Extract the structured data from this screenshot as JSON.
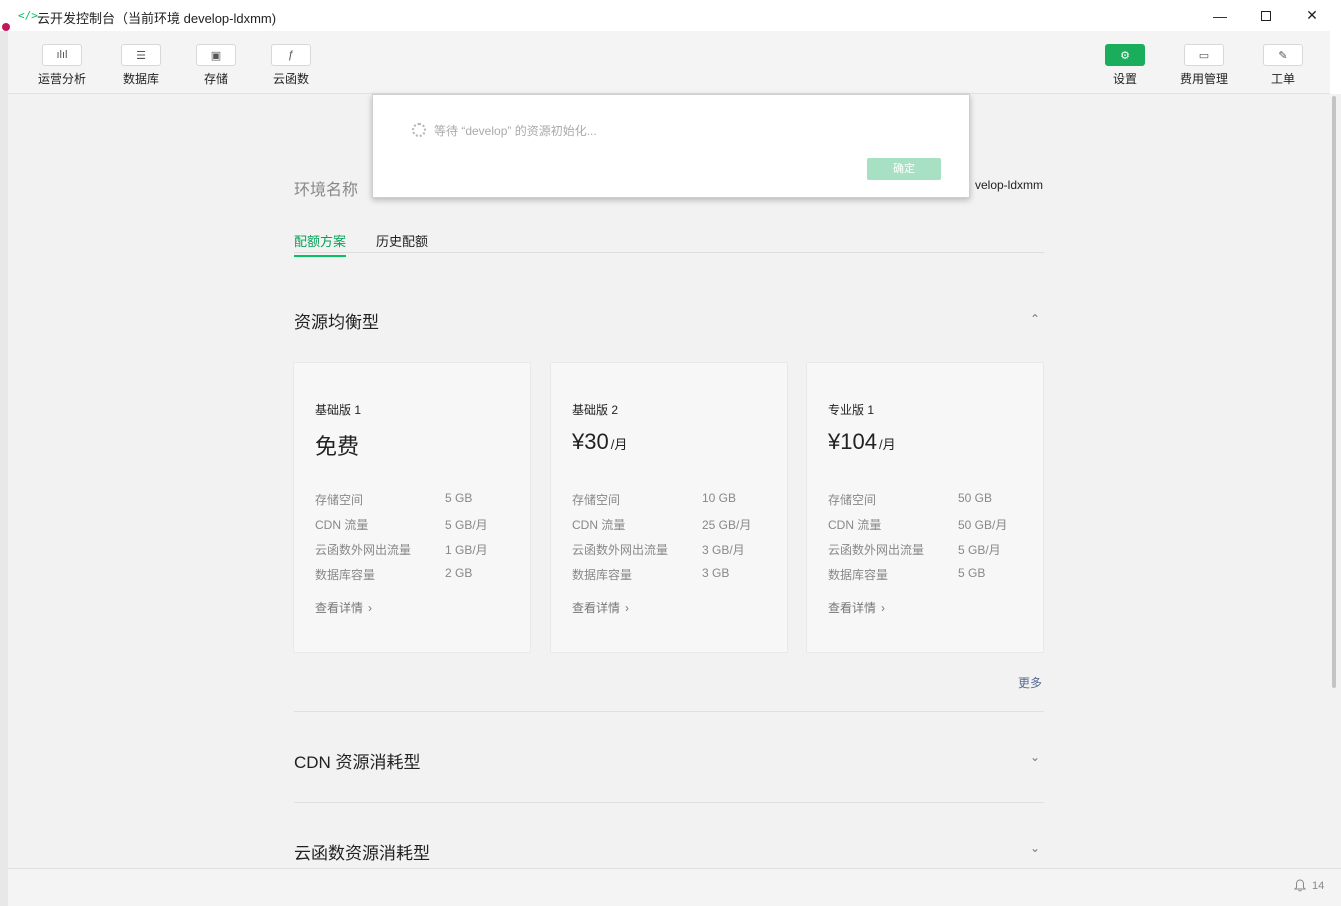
{
  "window": {
    "app_icon": "</>",
    "title": "云开发控制台（当前环境 develop-ldxmm)",
    "minimize": "—",
    "close": "✕"
  },
  "toolbar": {
    "left": [
      {
        "label": "运营分析",
        "icon": "bar-chart-icon",
        "glyph": "ılıl"
      },
      {
        "label": "数据库",
        "icon": "database-icon",
        "glyph": "☰"
      },
      {
        "label": "存储",
        "icon": "storage-icon",
        "glyph": "▣"
      },
      {
        "label": "云函数",
        "icon": "function-icon",
        "glyph": "ƒ"
      }
    ],
    "right": [
      {
        "label": "设置",
        "icon": "gear-icon",
        "glyph": "⚙",
        "active": true
      },
      {
        "label": "费用管理",
        "icon": "billing-icon",
        "glyph": "▭"
      },
      {
        "label": "工单",
        "icon": "ticket-icon",
        "glyph": "✎"
      }
    ]
  },
  "env": {
    "label": "环境名称",
    "value": "velop-ldxmm"
  },
  "tabs": [
    {
      "label": "配额方案",
      "active": true
    },
    {
      "label": "历史配额",
      "active": false
    }
  ],
  "sections": [
    {
      "title": "资源均衡型",
      "chevron": "⌃",
      "expanded": true
    },
    {
      "title": "CDN 资源消耗型",
      "chevron": "⌄",
      "expanded": false
    },
    {
      "title": "云函数资源消耗型",
      "chevron": "⌄",
      "expanded": false
    }
  ],
  "plans": [
    {
      "name": "基础版 1",
      "price": "免费",
      "unit": "",
      "specs": [
        {
          "k": "存储空间",
          "v": "5 GB"
        },
        {
          "k": "CDN 流量",
          "v": "5 GB/月"
        },
        {
          "k": "云函数外网出流量",
          "v": "1 GB/月"
        },
        {
          "k": "数据库容量",
          "v": "2 GB"
        }
      ],
      "details": "查看详情"
    },
    {
      "name": "基础版 2",
      "price": "¥30",
      "unit": "/月",
      "specs": [
        {
          "k": "存储空间",
          "v": "10 GB"
        },
        {
          "k": "CDN 流量",
          "v": "25 GB/月"
        },
        {
          "k": "云函数外网出流量",
          "v": "3 GB/月"
        },
        {
          "k": "数据库容量",
          "v": "3 GB"
        }
      ],
      "details": "查看详情"
    },
    {
      "name": "专业版 1",
      "price": "¥104",
      "unit": "/月",
      "specs": [
        {
          "k": "存储空间",
          "v": "50 GB"
        },
        {
          "k": "CDN 流量",
          "v": "50 GB/月"
        },
        {
          "k": "云函数外网出流量",
          "v": "5 GB/月"
        },
        {
          "k": "数据库容量",
          "v": "5 GB"
        }
      ],
      "details": "查看详情"
    }
  ],
  "more": "更多",
  "dialog": {
    "message": "等待 “develop” 的资源初始化...",
    "ok": "确定"
  },
  "status": {
    "notifications": "14"
  },
  "colors": {
    "accent": "#07c160",
    "link": "#576b95"
  }
}
